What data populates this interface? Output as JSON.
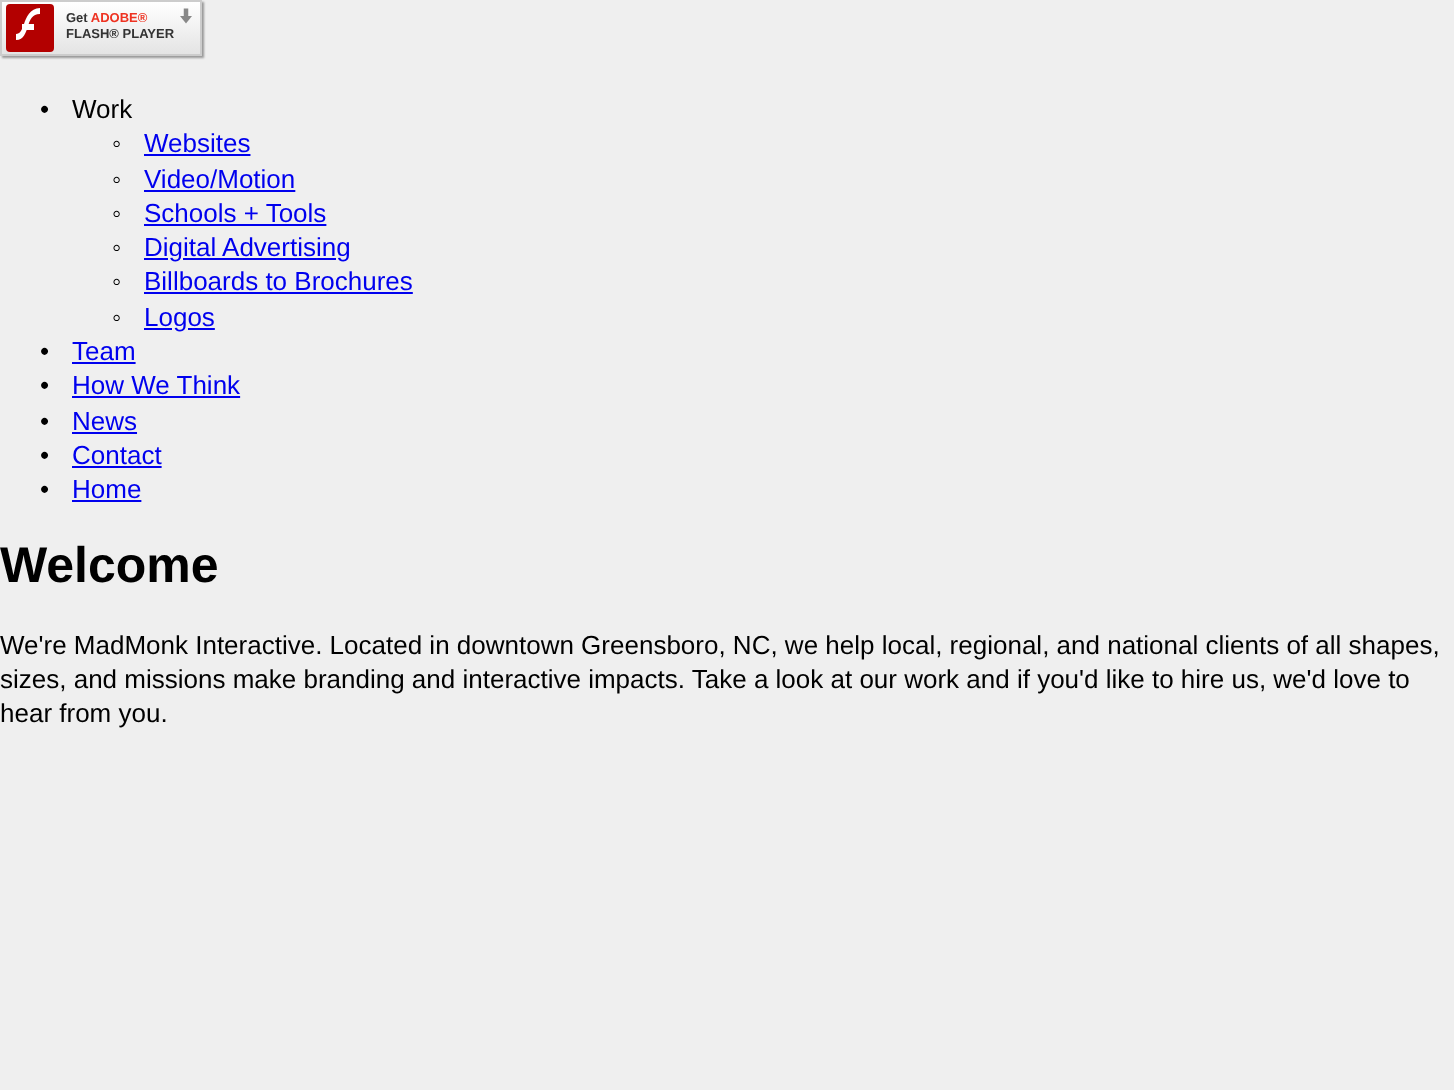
{
  "flash_badge": {
    "line_1_prefix": "Get",
    "line_1_brand": "ADOBE®",
    "line_2": "FLASH® PLAYER"
  },
  "nav": [
    {
      "marker": "•",
      "label": "Work",
      "link": false,
      "children": [
        {
          "marker": "◦",
          "label": "Websites",
          "link": true
        },
        {
          "marker": "◦",
          "label": "Video/Motion",
          "link": true
        },
        {
          "marker": "◦",
          "label": "Schools + Tools",
          "link": true
        },
        {
          "marker": "◦",
          "label": "Digital Advertising",
          "link": true
        },
        {
          "marker": "◦",
          "label": "Billboards to Brochures",
          "link": true
        },
        {
          "marker": "◦",
          "label": "Logos",
          "link": true
        }
      ]
    },
    {
      "marker": "•",
      "label": "Team",
      "link": true
    },
    {
      "marker": "•",
      "label": "How We Think",
      "link": true
    },
    {
      "marker": "•",
      "label": "News",
      "link": true
    },
    {
      "marker": "•",
      "label": "Contact",
      "link": true
    },
    {
      "marker": "•",
      "label": "Home",
      "link": true
    }
  ],
  "heading": "Welcome",
  "intro": "We're MadMonk Interactive. Located in downtown Greensboro, NC, we help local, regional, and national clients of all shapes, sizes, and missions make branding and interactive impacts. Take a look at our work and if you'd like to hire us, we'd love to hear from you."
}
